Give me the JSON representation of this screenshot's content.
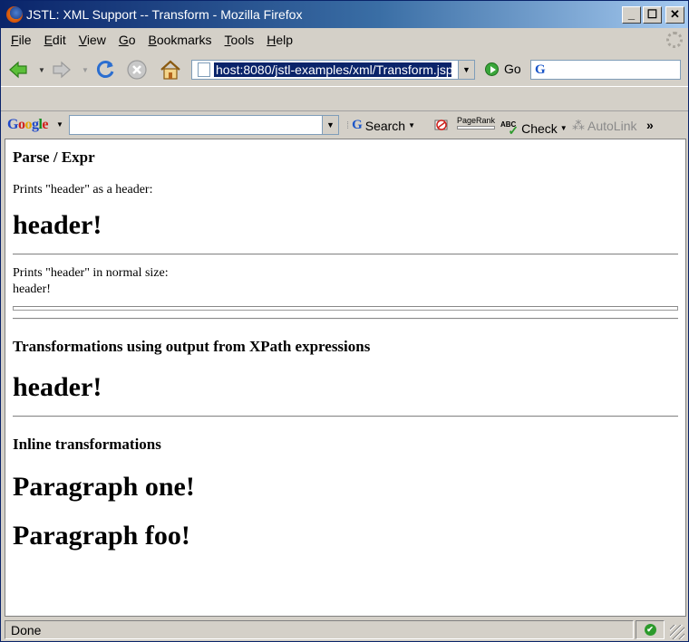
{
  "window": {
    "title": "JSTL: XML Support -- Transform - Mozilla Firefox",
    "controls": {
      "minimize": "_",
      "maximize": "☐",
      "close": "✕"
    }
  },
  "menubar": {
    "items": [
      {
        "key": "F",
        "rest": "ile"
      },
      {
        "key": "E",
        "rest": "dit"
      },
      {
        "key": "V",
        "rest": "iew"
      },
      {
        "key": "G",
        "rest": "o"
      },
      {
        "key": "B",
        "rest": "ookmarks"
      },
      {
        "key": "T",
        "rest": "ools"
      },
      {
        "key": "H",
        "rest": "elp"
      }
    ]
  },
  "navbar": {
    "url": "host:8080/jstl-examples/xml/Transform.jsp",
    "go_label": "Go"
  },
  "google_toolbar": {
    "logo": [
      "G",
      "o",
      "o",
      "g",
      "l",
      "e"
    ],
    "search_label": "Search",
    "pagerank_label": "PageRank",
    "check_label": "Check",
    "abc_label": "ABC",
    "autolink_label": "AutoLink",
    "more_label": "»"
  },
  "content": {
    "heading_parse": "Parse / Expr",
    "prints_header_as_header": "Prints \"header\" as a header:",
    "header1": "header!",
    "prints_header_normal": "Prints \"header\" in normal size:",
    "header_normal": "header!",
    "heading_transform": "Transformations using output from XPath expressions",
    "header2": "header!",
    "heading_inline": "Inline transformations",
    "paragraph_one": "Paragraph one!",
    "paragraph_foo": "Paragraph foo!"
  },
  "statusbar": {
    "text": "Done",
    "security_icon": "✔"
  },
  "colors": {
    "titlebar_start": "#0a246a",
    "titlebar_end": "#a6caf0",
    "chrome": "#d4d0c8",
    "url_selection": "#0a246a"
  }
}
